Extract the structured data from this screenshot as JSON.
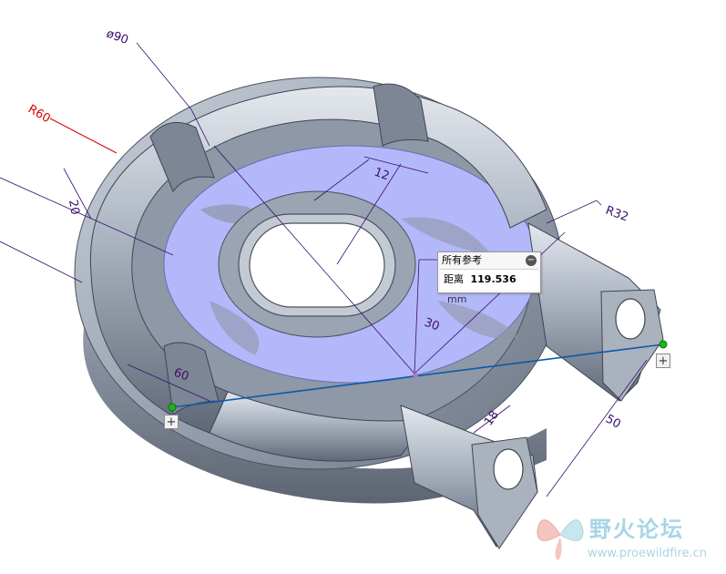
{
  "model_view": {
    "dimensions": {
      "dia90": "ø90",
      "r60": "R60",
      "d12": "12",
      "r32": "R32",
      "d30": "30",
      "d50": "50",
      "d18": "18",
      "d20": "20",
      "d60": "60"
    },
    "colors": {
      "body": "#9aa4b2",
      "plate": "#b3b8fb",
      "dimension": "#3a0e6e",
      "highlight_dim": "#e00000",
      "measure_line": "#0b5aa8"
    }
  },
  "measure_panel": {
    "title": "所有参考",
    "label": "距离",
    "value": "119.536",
    "unit": "mm",
    "collapse_icon": "minus-circle-icon"
  },
  "handles": {
    "left": "+",
    "right": "+"
  },
  "watermark": {
    "cn_text": "野火论坛",
    "url": "www.proewildfire.cn"
  }
}
